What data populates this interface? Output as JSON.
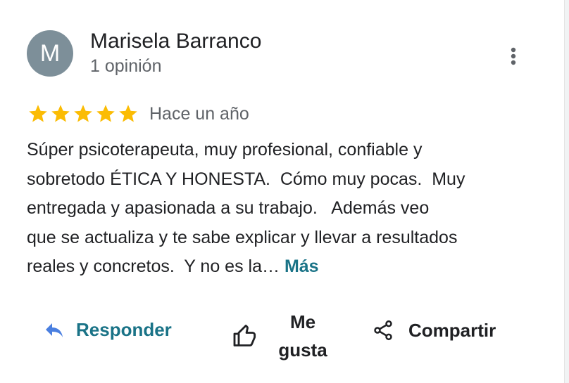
{
  "author": {
    "avatar_letter": "M",
    "avatar_color": "#7d8f99",
    "name": "Marisela Barranco",
    "review_count": "1 opinión"
  },
  "review": {
    "rating": 5,
    "max_rating": 5,
    "star_color": "#fbbc04",
    "time_ago": "Hace un año",
    "text_lines": [
      "Súper psicoterapeuta, muy profesional, confiable y",
      "sobretodo ÉTICA Y HONESTA.  Cómo muy pocas.  Muy",
      "entregada y apasionada a su trabajo.   Además veo",
      "que se actualiza y te sabe explicar y llevar a resultados",
      "reales y concretos.  Y no es la… "
    ],
    "more_label": "Más"
  },
  "actions": {
    "reply_label": "Responder",
    "like_label": "Me gusta",
    "share_label": "Compartir"
  },
  "icons": {
    "more": "more-vert-icon",
    "star": "star-icon",
    "reply": "reply-icon",
    "like": "thumb-up-icon",
    "share": "share-icon"
  },
  "colors": {
    "accent": "#1a7387",
    "reply_icon": "#4a7fe0"
  }
}
